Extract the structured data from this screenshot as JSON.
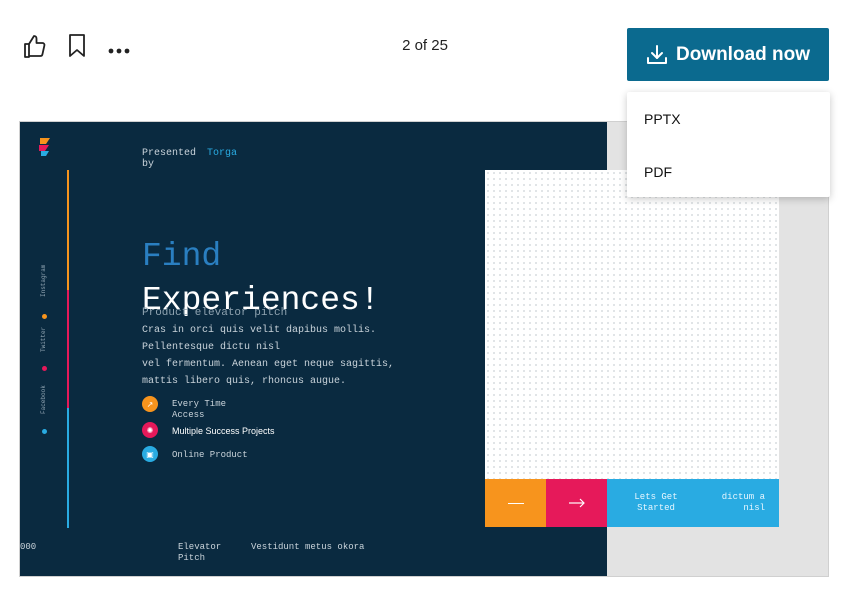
{
  "toolbar": {
    "like_icon": "thumbs-up-icon",
    "bookmark_icon": "bookmark-icon",
    "more_icon": "more-horizontal-icon",
    "page_counter": "2 of 25",
    "download_label": "Download now",
    "download_icon": "download-icon",
    "accent_color": "#0b6a8f"
  },
  "dropdown": {
    "items": [
      "PPTX",
      "PDF"
    ]
  },
  "slide": {
    "presented_by_label": "Presented by",
    "presenter_name": "Torga",
    "title_line1": "Find",
    "title_line2": "Experiences!",
    "overlay_subtitle": "Product elevator pitch",
    "body_lines": [
      "Cras in orci quis velit dapibus mollis.",
      "Pellentesque dictu nisl",
      "vel fermentum. Aenean eget neque sagittis,",
      "mattis libero quis, rhoncus augue."
    ],
    "features": [
      {
        "label": "Every Time Access",
        "color": "#f7941d"
      },
      {
        "label": "Multiple Success Projects",
        "color": "#e6195a"
      },
      {
        "label": "Online Product",
        "color": "#29abe2"
      }
    ],
    "social": [
      "Instagram",
      "Twitter",
      "Facebook"
    ],
    "footer_number": "000",
    "footer_label": "Elevator Pitch",
    "footer_text": "Vestidunt metus okora",
    "cta_button": "Lets Get Started",
    "cta_side_text": "dictum a nisl",
    "colors": {
      "navy": "#0a2a40",
      "orange": "#f7941d",
      "pink": "#e6195a",
      "blue": "#29abe2"
    }
  }
}
